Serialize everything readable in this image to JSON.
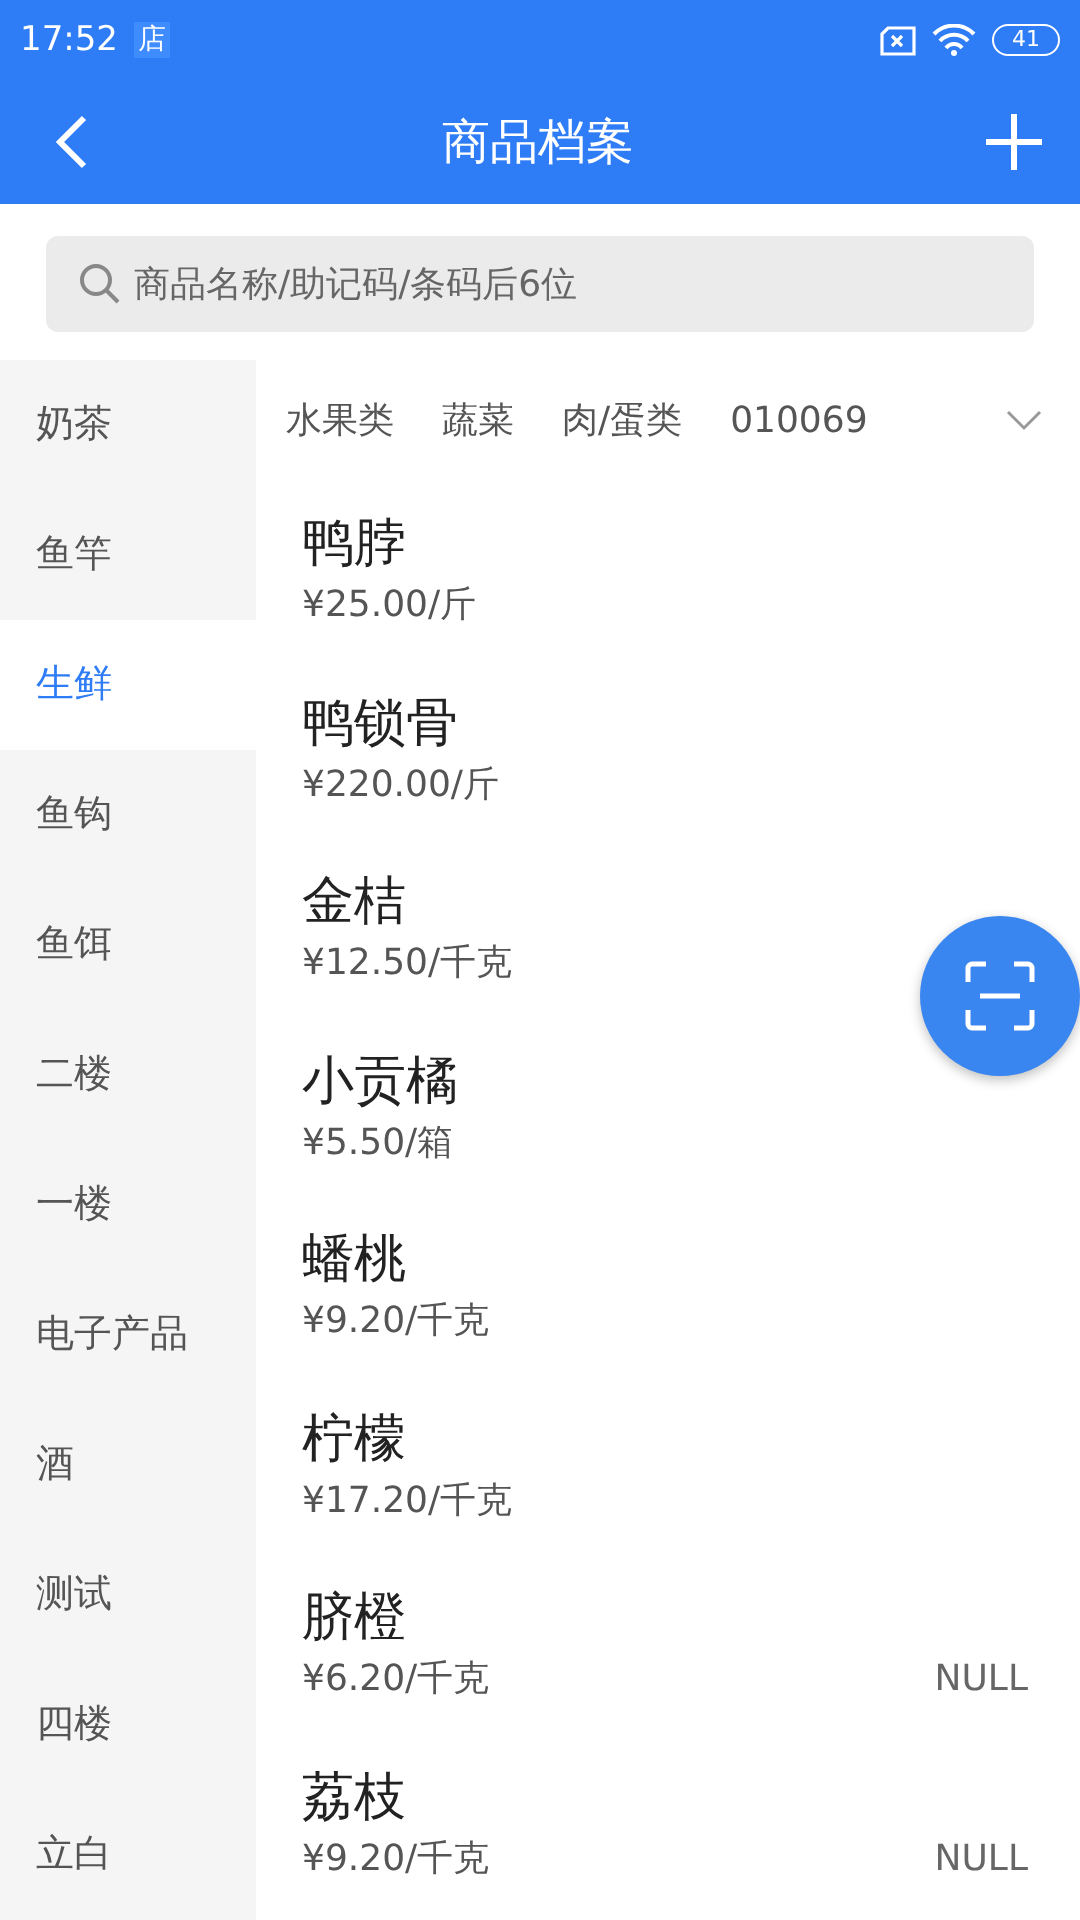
{
  "status_bar": {
    "time": "17:52",
    "app_badge": "店",
    "battery": "41"
  },
  "header": {
    "title": "商品档案"
  },
  "search": {
    "placeholder": "商品名称/助记码/条码后6位"
  },
  "sidebar": {
    "items": [
      {
        "label": "奶茶",
        "selected": false
      },
      {
        "label": "鱼竿",
        "selected": false
      },
      {
        "label": "生鲜",
        "selected": true
      },
      {
        "label": "鱼钩",
        "selected": false
      },
      {
        "label": "鱼饵",
        "selected": false
      },
      {
        "label": "二楼",
        "selected": false
      },
      {
        "label": "一楼",
        "selected": false
      },
      {
        "label": "电子产品",
        "selected": false
      },
      {
        "label": "酒",
        "selected": false
      },
      {
        "label": "测试",
        "selected": false
      },
      {
        "label": "四楼",
        "selected": false
      },
      {
        "label": "立白",
        "selected": false
      }
    ]
  },
  "subcategories": [
    {
      "label": "水果类"
    },
    {
      "label": "蔬菜"
    },
    {
      "label": "肉/蛋类"
    },
    {
      "label": "010069"
    }
  ],
  "products": [
    {
      "name": "鸭脖",
      "price": "¥25.00/斤"
    },
    {
      "name": "鸭锁骨",
      "price": "¥220.00/斤"
    },
    {
      "name": "金桔",
      "price": "¥12.50/千克"
    },
    {
      "name": "小贡橘",
      "price": "¥5.50/箱"
    },
    {
      "name": "蟠桃",
      "price": "¥9.20/千克"
    },
    {
      "name": "柠檬",
      "price": "¥17.20/千克"
    },
    {
      "name": "脐橙",
      "price": "¥6.20/千克",
      "tag": "NULL"
    },
    {
      "name": "荔枝",
      "price": "¥9.20/千克",
      "tag": "NULL"
    }
  ]
}
